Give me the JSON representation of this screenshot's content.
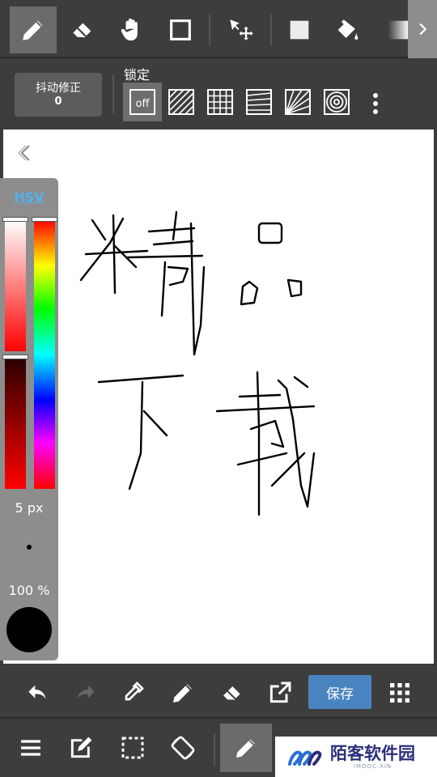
{
  "top_toolbar": {
    "tools": [
      "pen-tool",
      "eraser-tool",
      "hand-tool",
      "select-rect-tool",
      "move-tool",
      "fill-color-tool",
      "bucket-tool",
      "gradient-tool"
    ],
    "active_tool": "pen-tool"
  },
  "sub_toolbar": {
    "stabilizer_label": "抖动修正",
    "stabilizer_value": "0",
    "lock_label": "锁定",
    "off_label": "off"
  },
  "color_panel": {
    "mode_label": "HSV",
    "brush_size": "5 px",
    "opacity": "100 %",
    "current_color": "#000000"
  },
  "action_bar": {
    "save_label": "保存"
  },
  "watermark": {
    "title": "陌客软件园",
    "subtitle": "IMOOC.XIN"
  },
  "colors": {
    "toolbar_bg": "#3d3d3d",
    "active_tool_bg": "#6b6b6b",
    "save_button": "#4a84c0",
    "hsv_link": "#4fb3f0"
  }
}
